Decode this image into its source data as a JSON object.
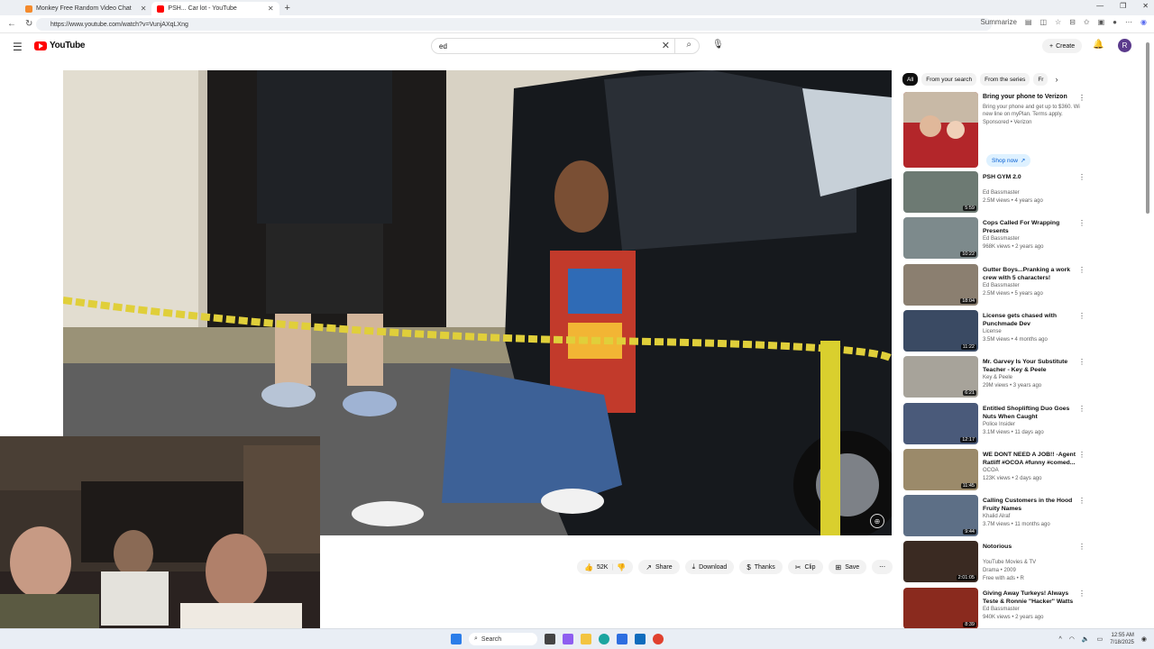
{
  "browser": {
    "tabs": [
      {
        "title": "Monkey Free Random Video Chat",
        "active": false,
        "favicon_color": "#f48a2c"
      },
      {
        "title": "PSH... Car lot - YouTube",
        "active": true,
        "favicon_color": "#ff0000"
      }
    ],
    "url": "https://www.youtube.com/watch?v=VunjAXqLXng",
    "summarize_label": "Summarize"
  },
  "youtube": {
    "logo_text": "YouTube",
    "search_value": "ed",
    "create_label": "Create",
    "avatar_letter": "R"
  },
  "actions": {
    "likes": "52K",
    "share": "Share",
    "download": "Download",
    "thanks": "Thanks",
    "clip": "Clip",
    "save": "Save"
  },
  "sidebar": {
    "chips": [
      "All",
      "From your search",
      "From the series",
      "Fr"
    ],
    "ad": {
      "title": "Bring your phone to Verizon",
      "description": "Bring your phone and get up to $360. Wi new line on myPlan. Terms apply.",
      "sponsor": "Sponsored • Verizon",
      "button": "Shop now"
    },
    "videos": [
      {
        "title": "PSH GYM 2.0",
        "channel": "Ed Bassmaster",
        "meta": "2.5M views • 4 years ago",
        "duration": "5:59",
        "thumb_color": "#6d7a73"
      },
      {
        "title": "Cops Called For Wrapping Presents",
        "channel": "Ed Bassmaster",
        "meta": "968K views • 2 years ago",
        "duration": "10:22",
        "thumb_color": "#7d8a8c"
      },
      {
        "title": "Gutter Boys...Pranking a work crew with 5 characters!",
        "channel": "Ed Bassmaster",
        "meta": "2.5M views • 5 years ago",
        "duration": "18:04",
        "thumb_color": "#8b7f70"
      },
      {
        "title": "License gets chased with Punchmade Dev",
        "channel": "License",
        "meta": "3.5M views • 4 months ago",
        "duration": "11:22",
        "thumb_color": "#3a4a63"
      },
      {
        "title": "Mr. Garvey Is Your Substitute Teacher - Key & Peele",
        "channel": "Key & Peele",
        "meta": "29M views • 3 years ago",
        "duration": "6:21",
        "thumb_color": "#a7a39a"
      },
      {
        "title": "Entitled Shoplifting Duo Goes Nuts When Caught",
        "channel": "Police Insider",
        "meta": "3.1M views • 11 days ago",
        "duration": "12:17",
        "thumb_color": "#4a5a7a"
      },
      {
        "title": "WE DONT NEED A JOB!! -Agent Ratliff #OCOA #funny #comed...",
        "channel": "OCOA",
        "meta": "123K views • 2 days ago",
        "duration": "11:45",
        "thumb_color": "#9b8a6a"
      },
      {
        "title": "Calling Customers in the Hood Fruity Names",
        "channel": "Khalid Alraf",
        "meta": "3.7M views • 11 months ago",
        "duration": "9:44",
        "thumb_color": "#5d6f86"
      },
      {
        "title": "Notorious",
        "channel": "YouTube Movies & TV",
        "meta": "Drama • 2009",
        "extra": "Free with ads • R",
        "duration": "2:01:05",
        "thumb_color": "#3a2a22"
      },
      {
        "title": "Giving Away Turkeys! Always Teste & Ronnie \"Hacker\" Watts",
        "channel": "Ed Bassmaster",
        "meta": "940K views • 2 years ago",
        "duration": "8:39",
        "thumb_color": "#8a2a1e"
      }
    ]
  },
  "taskbar": {
    "search_label": "Search",
    "time": "12:55 AM",
    "date": "7/18/2025"
  }
}
